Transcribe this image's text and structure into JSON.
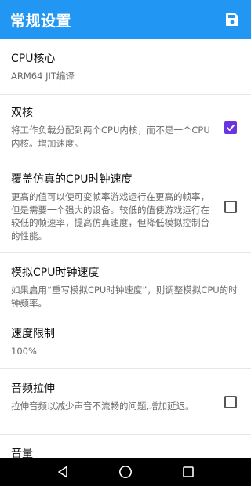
{
  "appbar": {
    "title": "常规设置",
    "save_icon": "save-icon"
  },
  "settings": [
    {
      "title": "CPU核心",
      "summary": "ARM64 JIT编译",
      "checkbox": null
    },
    {
      "title": "双核",
      "summary": "将工作负载分配到两个CPU内核，而不是一个CPU内核。增加速度。",
      "checkbox": true
    },
    {
      "title": "覆盖仿真的CPU时钟速度",
      "summary": "更高的值可以使可变帧率游戏运行在更高的帧率，但是需要一个强大的设备。较低的值使游戏运行在较低的帧速率，提高仿真速度，但降低模拟控制台的性能。",
      "checkbox": false
    },
    {
      "title": "模拟CPU时钟速度",
      "summary": "如果启用“重写模拟CPU时钟速度”，则调整模拟CPU的时钟频率。",
      "checkbox": null
    },
    {
      "title": "速度限制",
      "summary": "100%",
      "checkbox": null
    },
    {
      "title": "音频拉伸",
      "summary": "拉伸音频以减少声音不流畅的问题,增加延迟。",
      "checkbox": false
    },
    {
      "title": "音量",
      "summary": "",
      "checkbox": null
    }
  ],
  "navbar": {
    "back_icon": "back-icon",
    "home_icon": "home-icon",
    "recents_icon": "recents-icon"
  },
  "colors": {
    "primary": "#2196f3",
    "checkbox_checked": "#6a35e0"
  }
}
